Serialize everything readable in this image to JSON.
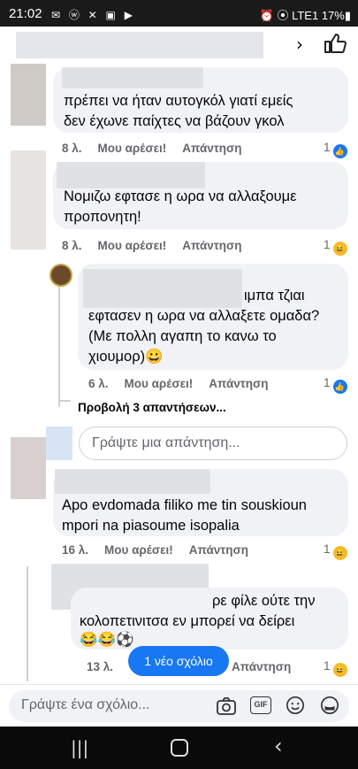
{
  "status_bar": {
    "time": "21:02",
    "icons": "✉ ⓦ ✕ ▣ ▶",
    "right": "⏰ ⦿ LTE1 17%▮"
  },
  "comments": [
    {
      "text1": "πρέπει να ήταν αυτογκόλ γιατί εμείς",
      "text2": "δεν έχωνε παίχτες να βάζουν γκολ",
      "time": "8 λ.",
      "like": "Μου αρέσει!",
      "reply": "Απάντηση",
      "reactions": "1"
    },
    {
      "text1": "Νομιζω εφτασε η ωρα να αλλαξουμε",
      "text2": "προπονητη!",
      "time": "8 λ.",
      "like": "Μου αρέσει!",
      "reply": "Απάντηση",
      "reactions": "1"
    },
    {
      "text1": "ιμπα τζιαι",
      "text2": "εφτασεν η ωρα να αλλαξετε ομαδα?",
      "text3": "(Με πολλη αγαπη το κανω το",
      "text4": "χιουμορ)😀",
      "time": "6 λ.",
      "like": "Μου αρέσει!",
      "reply": "Απάντηση",
      "reactions": "1"
    },
    {
      "text1": "Apo evdomada filiko me tin souskioun",
      "text2": "mpori na piasoume isopalia",
      "time": "16 λ.",
      "like": "Μου αρέσει!",
      "reply": "Απάντηση",
      "reactions": "1"
    },
    {
      "text1": "ρε φίλε ούτε την",
      "text2": "κολοπετινιτσα εν μπορεί να δείρει",
      "text3": "😂😂⚽",
      "time": "13 λ.",
      "reply": "Απάντηση",
      "reactions": "1"
    }
  ],
  "view_replies": "Προβολή 3 απαντήσεων...",
  "reply_placeholder": "Γράψτε μια απάντηση...",
  "new_comment": "1 νέο σχόλιο",
  "composer_placeholder": "Γράψτε ένα σχόλιο...",
  "composer_icons": [
    "camera-icon",
    "gif-icon",
    "emoji-icon",
    "sticker-icon"
  ],
  "gif_label": "GIF",
  "accent_color": "#1877f2"
}
